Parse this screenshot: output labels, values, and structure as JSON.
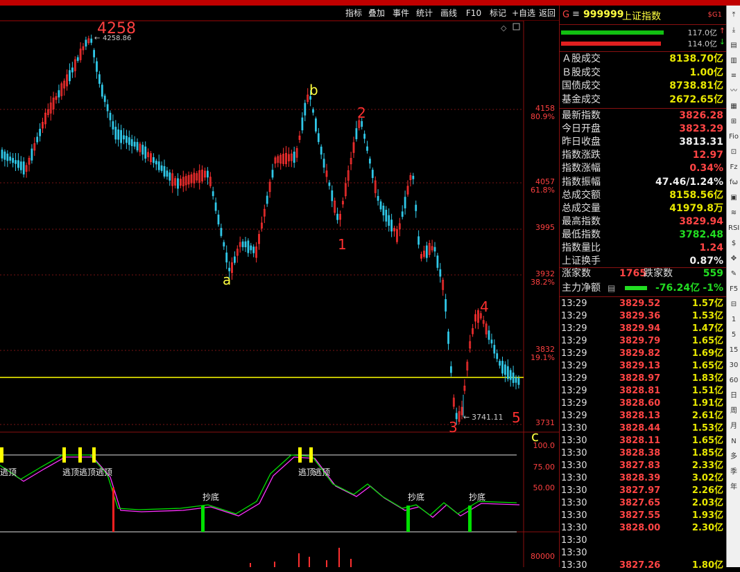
{
  "menu": {
    "items": [
      "指标",
      "叠加",
      "事件",
      "统计",
      "画线",
      "F10",
      "标记",
      "+自选",
      "返回"
    ]
  },
  "chart": {
    "high_label": "4258",
    "high_value": "4258.86",
    "low_value": "3741.11",
    "price_axis": [
      {
        "price": "4158",
        "pct": "80.9%"
      },
      {
        "price": "4057",
        "pct": "61.8%"
      },
      {
        "price": "3995",
        "pct": ""
      },
      {
        "price": "3932",
        "pct": "38.2%"
      },
      {
        "price": "3832",
        "pct": "19.1%"
      },
      {
        "price": "3731",
        "pct": ""
      }
    ],
    "wave_labels": {
      "a": "a",
      "b": "b",
      "c": "c",
      "w1": "1",
      "w2": "2",
      "w3": "3",
      "w4": "4",
      "w5": "5"
    },
    "indicator_axis": [
      "100.0",
      "75.00",
      "50.00"
    ],
    "signal_top": "逃顶",
    "signal_bottom": "抄底",
    "volume_axis": "80000",
    "colors": {
      "up": "#ff3030",
      "down": "#30c8e8",
      "yellow": "#ffff00",
      "green": "#00e000",
      "magenta": "#ff30ff"
    }
  },
  "panel": {
    "code": "999999",
    "name": "上证指数",
    "tag": "$G1",
    "bar_vals": [
      "117.0亿",
      "114.0亿"
    ],
    "stats": [
      {
        "label": "Ａ股成交",
        "value": "8138.70亿",
        "cls": "yellow"
      },
      {
        "label": "Ｂ股成交",
        "value": "1.00亿",
        "cls": "yellow"
      },
      {
        "label": "国债成交",
        "value": "8738.81亿",
        "cls": "yellow"
      },
      {
        "label": "基金成交",
        "value": "2672.65亿",
        "cls": "yellow"
      }
    ],
    "quote": [
      {
        "label": "最新指数",
        "value": "3826.28",
        "cls": "red"
      },
      {
        "label": "今日开盘",
        "value": "3823.29",
        "cls": "red"
      },
      {
        "label": "昨日收盘",
        "value": "3813.31",
        "cls": "white"
      },
      {
        "label": "指数涨跌",
        "value": "12.97",
        "cls": "red"
      },
      {
        "label": "指数涨幅",
        "value": "0.34%",
        "cls": "red"
      },
      {
        "label": "指数振幅",
        "value": "47.46/1.24%",
        "cls": "white"
      },
      {
        "label": "总成交额",
        "value": "8158.56亿",
        "cls": "yellow"
      },
      {
        "label": "总成交量",
        "value": "41979.8万",
        "cls": "yellow"
      },
      {
        "label": "最高指数",
        "value": "3829.94",
        "cls": "red"
      },
      {
        "label": "最低指数",
        "value": "3782.48",
        "cls": "green"
      },
      {
        "label": "指数量比",
        "value": "1.24",
        "cls": "red"
      },
      {
        "label": "上证换手",
        "value": "0.87%",
        "cls": "white"
      }
    ],
    "up_label": "涨家数",
    "up_value": "1765",
    "down_label": "跌家数",
    "down_value": "559",
    "flow_label": "主力净额",
    "flow_value": "-76.24亿",
    "flow_pct": "-1%",
    "ticks": [
      {
        "t": "13:29",
        "p": "3829.52",
        "v": "1.57亿"
      },
      {
        "t": "13:29",
        "p": "3829.36",
        "v": "1.53亿"
      },
      {
        "t": "13:29",
        "p": "3829.94",
        "v": "1.47亿"
      },
      {
        "t": "13:29",
        "p": "3829.79",
        "v": "1.65亿"
      },
      {
        "t": "13:29",
        "p": "3829.82",
        "v": "1.69亿"
      },
      {
        "t": "13:29",
        "p": "3829.13",
        "v": "1.65亿"
      },
      {
        "t": "13:29",
        "p": "3828.97",
        "v": "1.83亿"
      },
      {
        "t": "13:29",
        "p": "3828.81",
        "v": "1.51亿"
      },
      {
        "t": "13:29",
        "p": "3828.60",
        "v": "1.91亿"
      },
      {
        "t": "13:29",
        "p": "3828.13",
        "v": "2.61亿"
      },
      {
        "t": "13:30",
        "p": "3828.44",
        "v": "1.53亿"
      },
      {
        "t": "13:30",
        "p": "3828.11",
        "v": "1.65亿"
      },
      {
        "t": "13:30",
        "p": "3828.38",
        "v": "1.85亿"
      },
      {
        "t": "13:30",
        "p": "3827.83",
        "v": "2.33亿"
      },
      {
        "t": "13:30",
        "p": "3828.39",
        "v": "3.02亿"
      },
      {
        "t": "13:30",
        "p": "3827.97",
        "v": "2.26亿"
      },
      {
        "t": "13:30",
        "p": "3827.65",
        "v": "2.03亿"
      },
      {
        "t": "13:30",
        "p": "3827.55",
        "v": "1.93亿"
      },
      {
        "t": "13:30",
        "p": "3828.00",
        "v": "2.30亿"
      },
      {
        "t": "13:30",
        "p": "",
        "v": ""
      },
      {
        "t": "13:30",
        "p": "",
        "v": ""
      },
      {
        "t": "13:30",
        "p": "3827.26",
        "v": "1.80亿"
      }
    ],
    "tools": [
      "⤒",
      "⤓",
      "▤",
      "▥",
      "≡",
      "〰",
      "▦",
      "⊞",
      "Fio",
      "⊡",
      "Fz",
      "fω",
      "▣",
      "≋",
      "RSI",
      "$",
      "✥",
      "✎",
      "F5",
      "⊟",
      "1",
      "5",
      "15",
      "30",
      "60",
      "日",
      "周",
      "月",
      "N",
      "多",
      "季",
      "年"
    ]
  }
}
